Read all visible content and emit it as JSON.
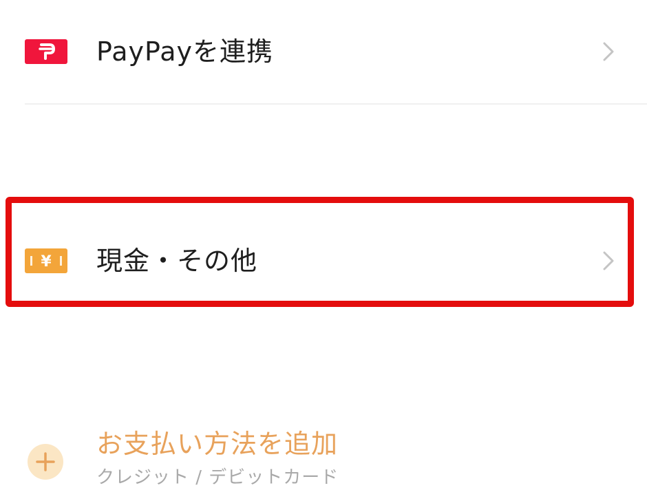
{
  "payment_methods": {
    "items": [
      {
        "label": "PayPayを連携",
        "icon": "paypay-icon",
        "icon_glyph": "P",
        "color": "#f0163c"
      },
      {
        "label": "現金・その他",
        "icon": "cash-icon",
        "icon_glyph": "¥",
        "color": "#f3a53a"
      }
    ],
    "add": {
      "title": "お支払い方法を追加",
      "subtitle": "クレジット / デビットカード",
      "icon": "plus-icon",
      "title_color": "#e8a25b",
      "highlight_color": "#e40d0d"
    }
  }
}
